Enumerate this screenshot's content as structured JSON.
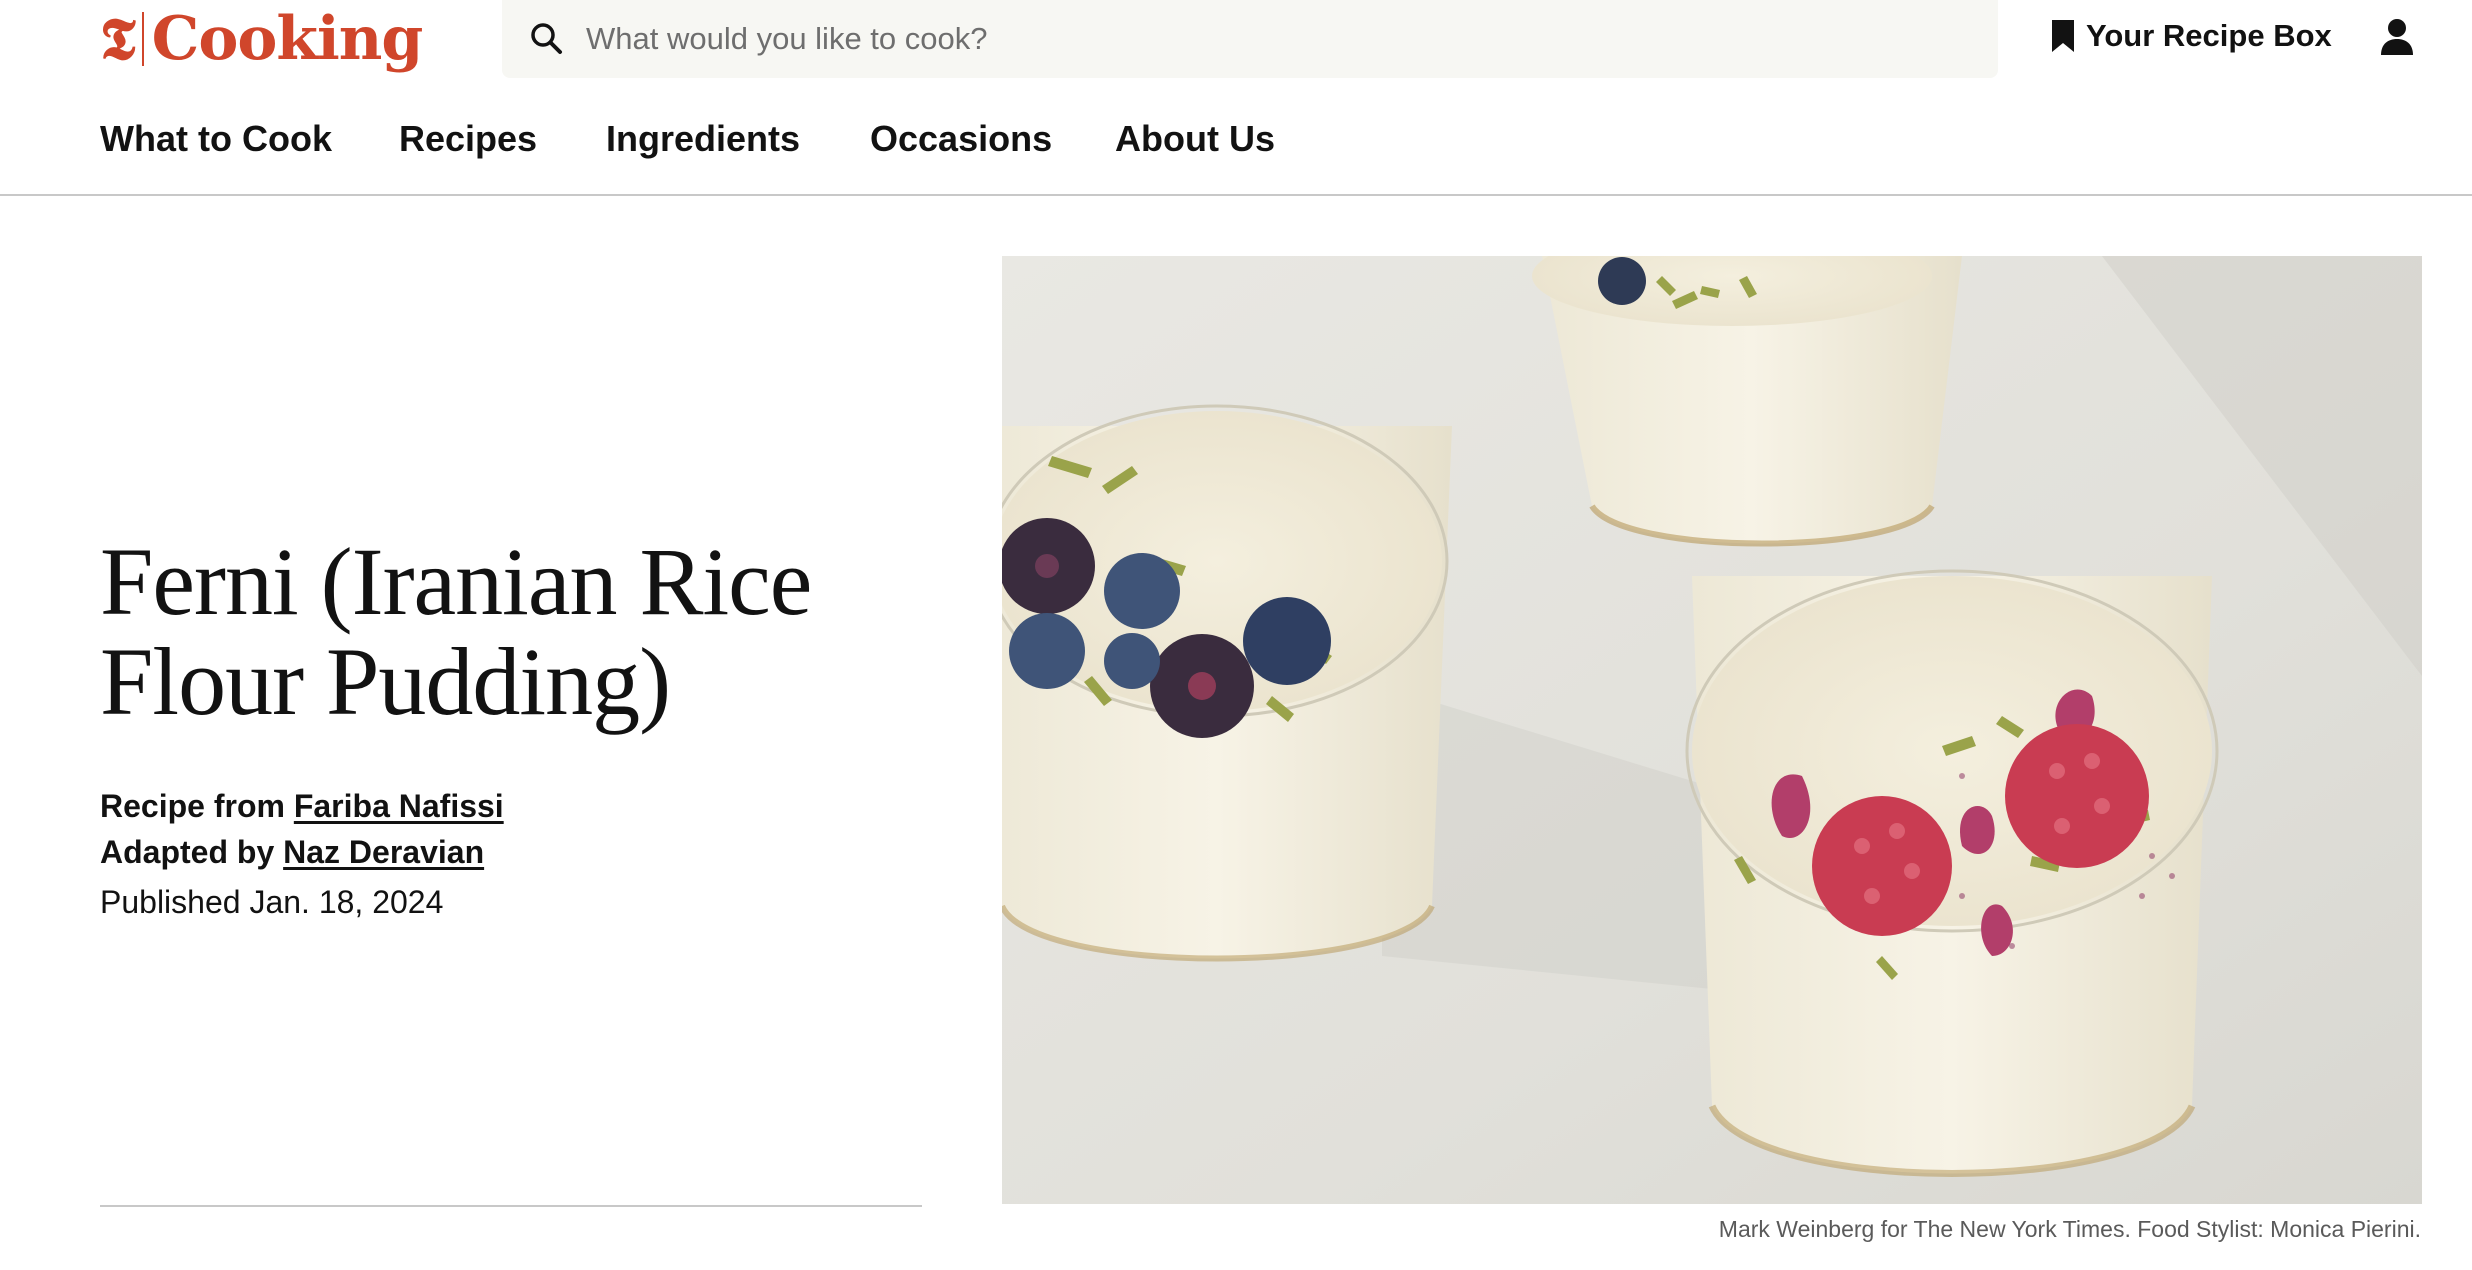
{
  "header": {
    "logo_mark": "𝕿",
    "logo_word": "Cooking",
    "search_placeholder": "What would you like to cook?",
    "recipe_box_label": "Your Recipe Box",
    "brand_color": "#d0462b"
  },
  "nav": {
    "items": [
      {
        "label": "What to Cook"
      },
      {
        "label": "Recipes"
      },
      {
        "label": "Ingredients"
      },
      {
        "label": "Occasions"
      },
      {
        "label": "About Us"
      }
    ]
  },
  "recipe": {
    "title": "Ferni (Iranian Rice Flour Pudding)",
    "recipe_from_prefix": "Recipe from",
    "recipe_from_author": "Fariba Nafissi",
    "adapted_by_prefix": "Adapted by",
    "adapted_by_author": "Naz Deravian",
    "published": "Published Jan. 18, 2024"
  },
  "photo": {
    "caption": "Mark Weinberg for The New York Times. Food Stylist: Monica Pierini."
  }
}
